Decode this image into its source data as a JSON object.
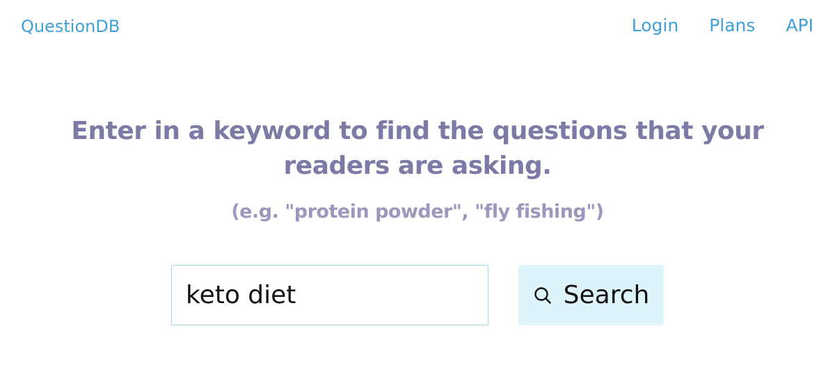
{
  "header": {
    "brand": "QuestionDB",
    "nav": [
      {
        "label": "Login"
      },
      {
        "label": "Plans"
      },
      {
        "label": "API"
      }
    ]
  },
  "main": {
    "headline": "Enter in a keyword to find the questions that your readers are asking.",
    "example": "(e.g. \"protein powder\", \"fly fishing\")",
    "search": {
      "value": "keto diet",
      "button_label": "Search",
      "button_icon": "search-icon"
    }
  },
  "colors": {
    "link": "#3f9fd8",
    "headline": "#7c7ba6",
    "example": "#9a98bc",
    "input_border": "#9fd8ea",
    "button_bg": "#ddf4fa"
  }
}
